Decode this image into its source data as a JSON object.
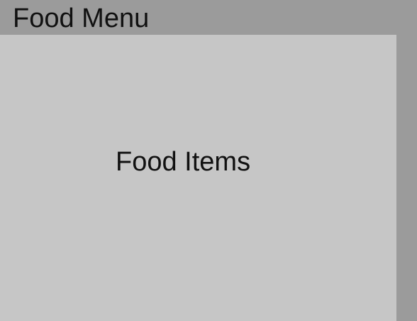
{
  "header": {
    "title": "Food Menu"
  },
  "panel": {
    "label": "Food Items"
  },
  "colors": {
    "background": "#9b9b9b",
    "panel": "#c6c6c6",
    "text": "#111111"
  }
}
